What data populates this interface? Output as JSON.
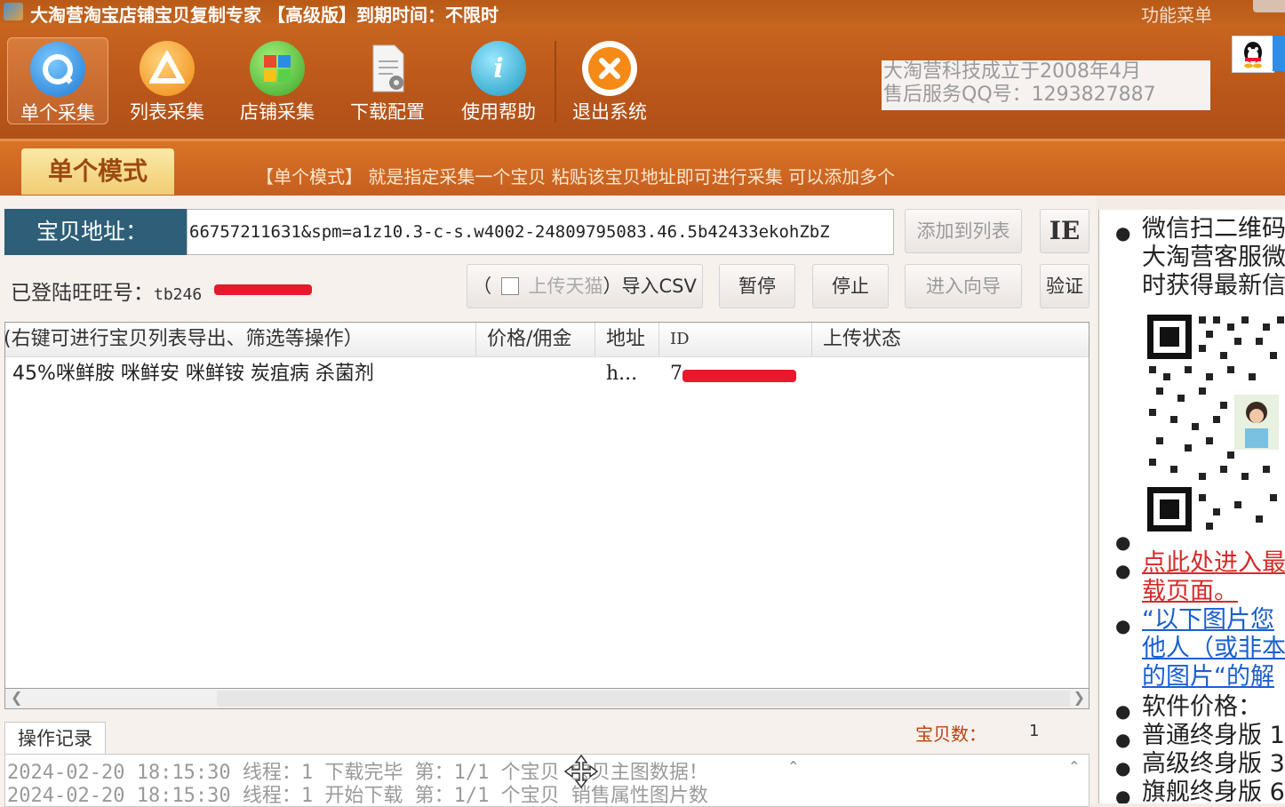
{
  "window": {
    "title": "大淘营淘宝店铺宝贝复制专家 【高级版】到期时间：不限时",
    "function_menu": "功能菜单"
  },
  "toolbar": {
    "items": [
      {
        "label": "单个采集",
        "icon": "search-icon",
        "color": "#2a8ee0"
      },
      {
        "label": "列表采集",
        "icon": "triangle-icon",
        "color": "#f39a1c"
      },
      {
        "label": "店铺采集",
        "icon": "store-icon",
        "color": "#44b830"
      },
      {
        "label": "下载配置",
        "icon": "document-gear-icon",
        "color": "#cccccc"
      },
      {
        "label": "使用帮助",
        "icon": "info-icon",
        "color": "#28a8c8"
      },
      {
        "label": "退出系统",
        "icon": "close-icon",
        "color": "#f08a1a"
      }
    ]
  },
  "company_info": {
    "line1": "大淘营科技成立于2008年4月",
    "line2": "售后服务QQ号：1293827887"
  },
  "mode": {
    "tab_label": "单个模式",
    "description": "【单个模式】 就是指定采集一个宝贝 粘贴该宝贝地址即可进行采集 可以添加多个"
  },
  "address": {
    "label": "宝贝地址：",
    "value": "66757211631&spm=a1z10.3-c-s.w4002-24809795083.46.5b42433ekohZbZ",
    "add_button": "添加到列表",
    "ie_button": "IE"
  },
  "account": {
    "label": "已登陆旺旺号：",
    "value": "tb246"
  },
  "actions": {
    "tmall_open": "（",
    "tmall_label": "上传天猫",
    "tmall_close": "）导入CSV",
    "pause": "暂停",
    "stop": "停止",
    "wizard": "进入向导",
    "verify": "验证"
  },
  "table": {
    "columns": [
      "(右键可进行宝贝列表导出、筛选等操作）",
      "价格/佣金",
      "地址",
      "ID",
      "上传状态"
    ],
    "rows": [
      {
        "title": "45%咪鲜胺 咪鲜安 咪鲜铵 炭疽病 杀菌剂",
        "price": "",
        "addr": "h...",
        "id": "7",
        "status": ""
      }
    ]
  },
  "log": {
    "tab_label": "操作记录",
    "count_label": "宝贝数：",
    "count_value": "1",
    "lines": [
      "2024-02-20 18:15:30 线程：1  下载完毕 第：1/1  个宝贝  宝贝主图数据！",
      "2024-02-20 18:15:30 线程：1  开始下载 第：1/1  个宝贝  销售属性图片数"
    ]
  },
  "sidebar": {
    "wechat_text_1": "微信扫二维码",
    "wechat_text_2": "大淘营客服微",
    "wechat_text_3": "时获得最新信",
    "download_link_1": "点此处进入最",
    "download_link_2": "载页面。",
    "image_note_1": "“以下图片您",
    "image_note_2": "他人（或非本",
    "image_note_3": "的图片“的解",
    "price_title": "软件价格：",
    "edition_1": "普通终身版",
    "edition_2": "高级终身版",
    "edition_3": "旗舰终身版",
    "edition_1_price": "1",
    "edition_2_price": "3",
    "edition_3_price": "6"
  },
  "colors": {
    "titlebar": "#b95a17",
    "toolbar": "#c8651f",
    "mode_tab": "#f1cd74",
    "address_label": "#2e5e78",
    "redaction": "#e8192c"
  }
}
